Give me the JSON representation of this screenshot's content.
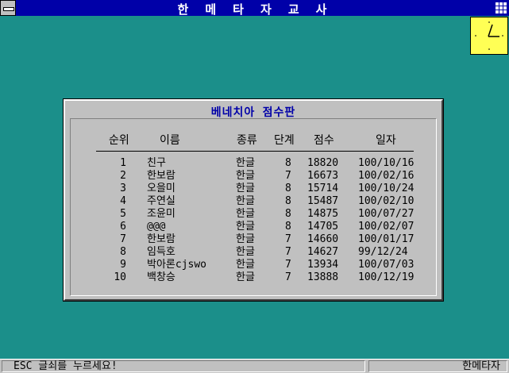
{
  "app": {
    "title": "한 메 타 자 교 사"
  },
  "dialog": {
    "title": "베네치아 점수판",
    "headers": {
      "rank": "순위",
      "name": "이름",
      "kind": "종류",
      "level": "단계",
      "score": "점수",
      "date": "일자"
    },
    "rows": [
      {
        "rank": "1",
        "name": "친구",
        "kind": "한글",
        "level": "8",
        "score": "18820",
        "date": "100/10/16"
      },
      {
        "rank": "2",
        "name": "한보람",
        "kind": "한글",
        "level": "7",
        "score": "16673",
        "date": "100/02/16"
      },
      {
        "rank": "3",
        "name": "오을미",
        "kind": "한글",
        "level": "8",
        "score": "15714",
        "date": "100/10/24"
      },
      {
        "rank": "4",
        "name": "주연실",
        "kind": "한글",
        "level": "8",
        "score": "15487",
        "date": "100/02/10"
      },
      {
        "rank": "5",
        "name": "조윤미",
        "kind": "한글",
        "level": "8",
        "score": "14875",
        "date": "100/07/27"
      },
      {
        "rank": "6",
        "name": "@@@",
        "kind": "한글",
        "level": "8",
        "score": "14705",
        "date": "100/02/07"
      },
      {
        "rank": "7",
        "name": "한보람",
        "kind": "한글",
        "level": "7",
        "score": "14660",
        "date": "100/01/17"
      },
      {
        "rank": "8",
        "name": "임득호",
        "kind": "한글",
        "level": "7",
        "score": "14627",
        "date": "99/12/24"
      },
      {
        "rank": "9",
        "name": "박아론cjswo",
        "kind": "한글",
        "level": "7",
        "score": "13934",
        "date": "100/07/03"
      },
      {
        "rank": "10",
        "name": "백창승",
        "kind": "한글",
        "level": "7",
        "score": "13888",
        "date": "100/12/19"
      }
    ]
  },
  "statusbar": {
    "hint": "ESC 글쇠를 누르세요!",
    "app_name": "한메타자"
  },
  "icons": {
    "system_menu": "system-menu-icon",
    "grid": "grid-menu-icon",
    "clock": "clock-icon"
  },
  "colors": {
    "desktop": "#1b8f8a",
    "titlebar": "#0000a8",
    "dialog_title": "#0000a8",
    "clock_face": "#ffff55"
  }
}
